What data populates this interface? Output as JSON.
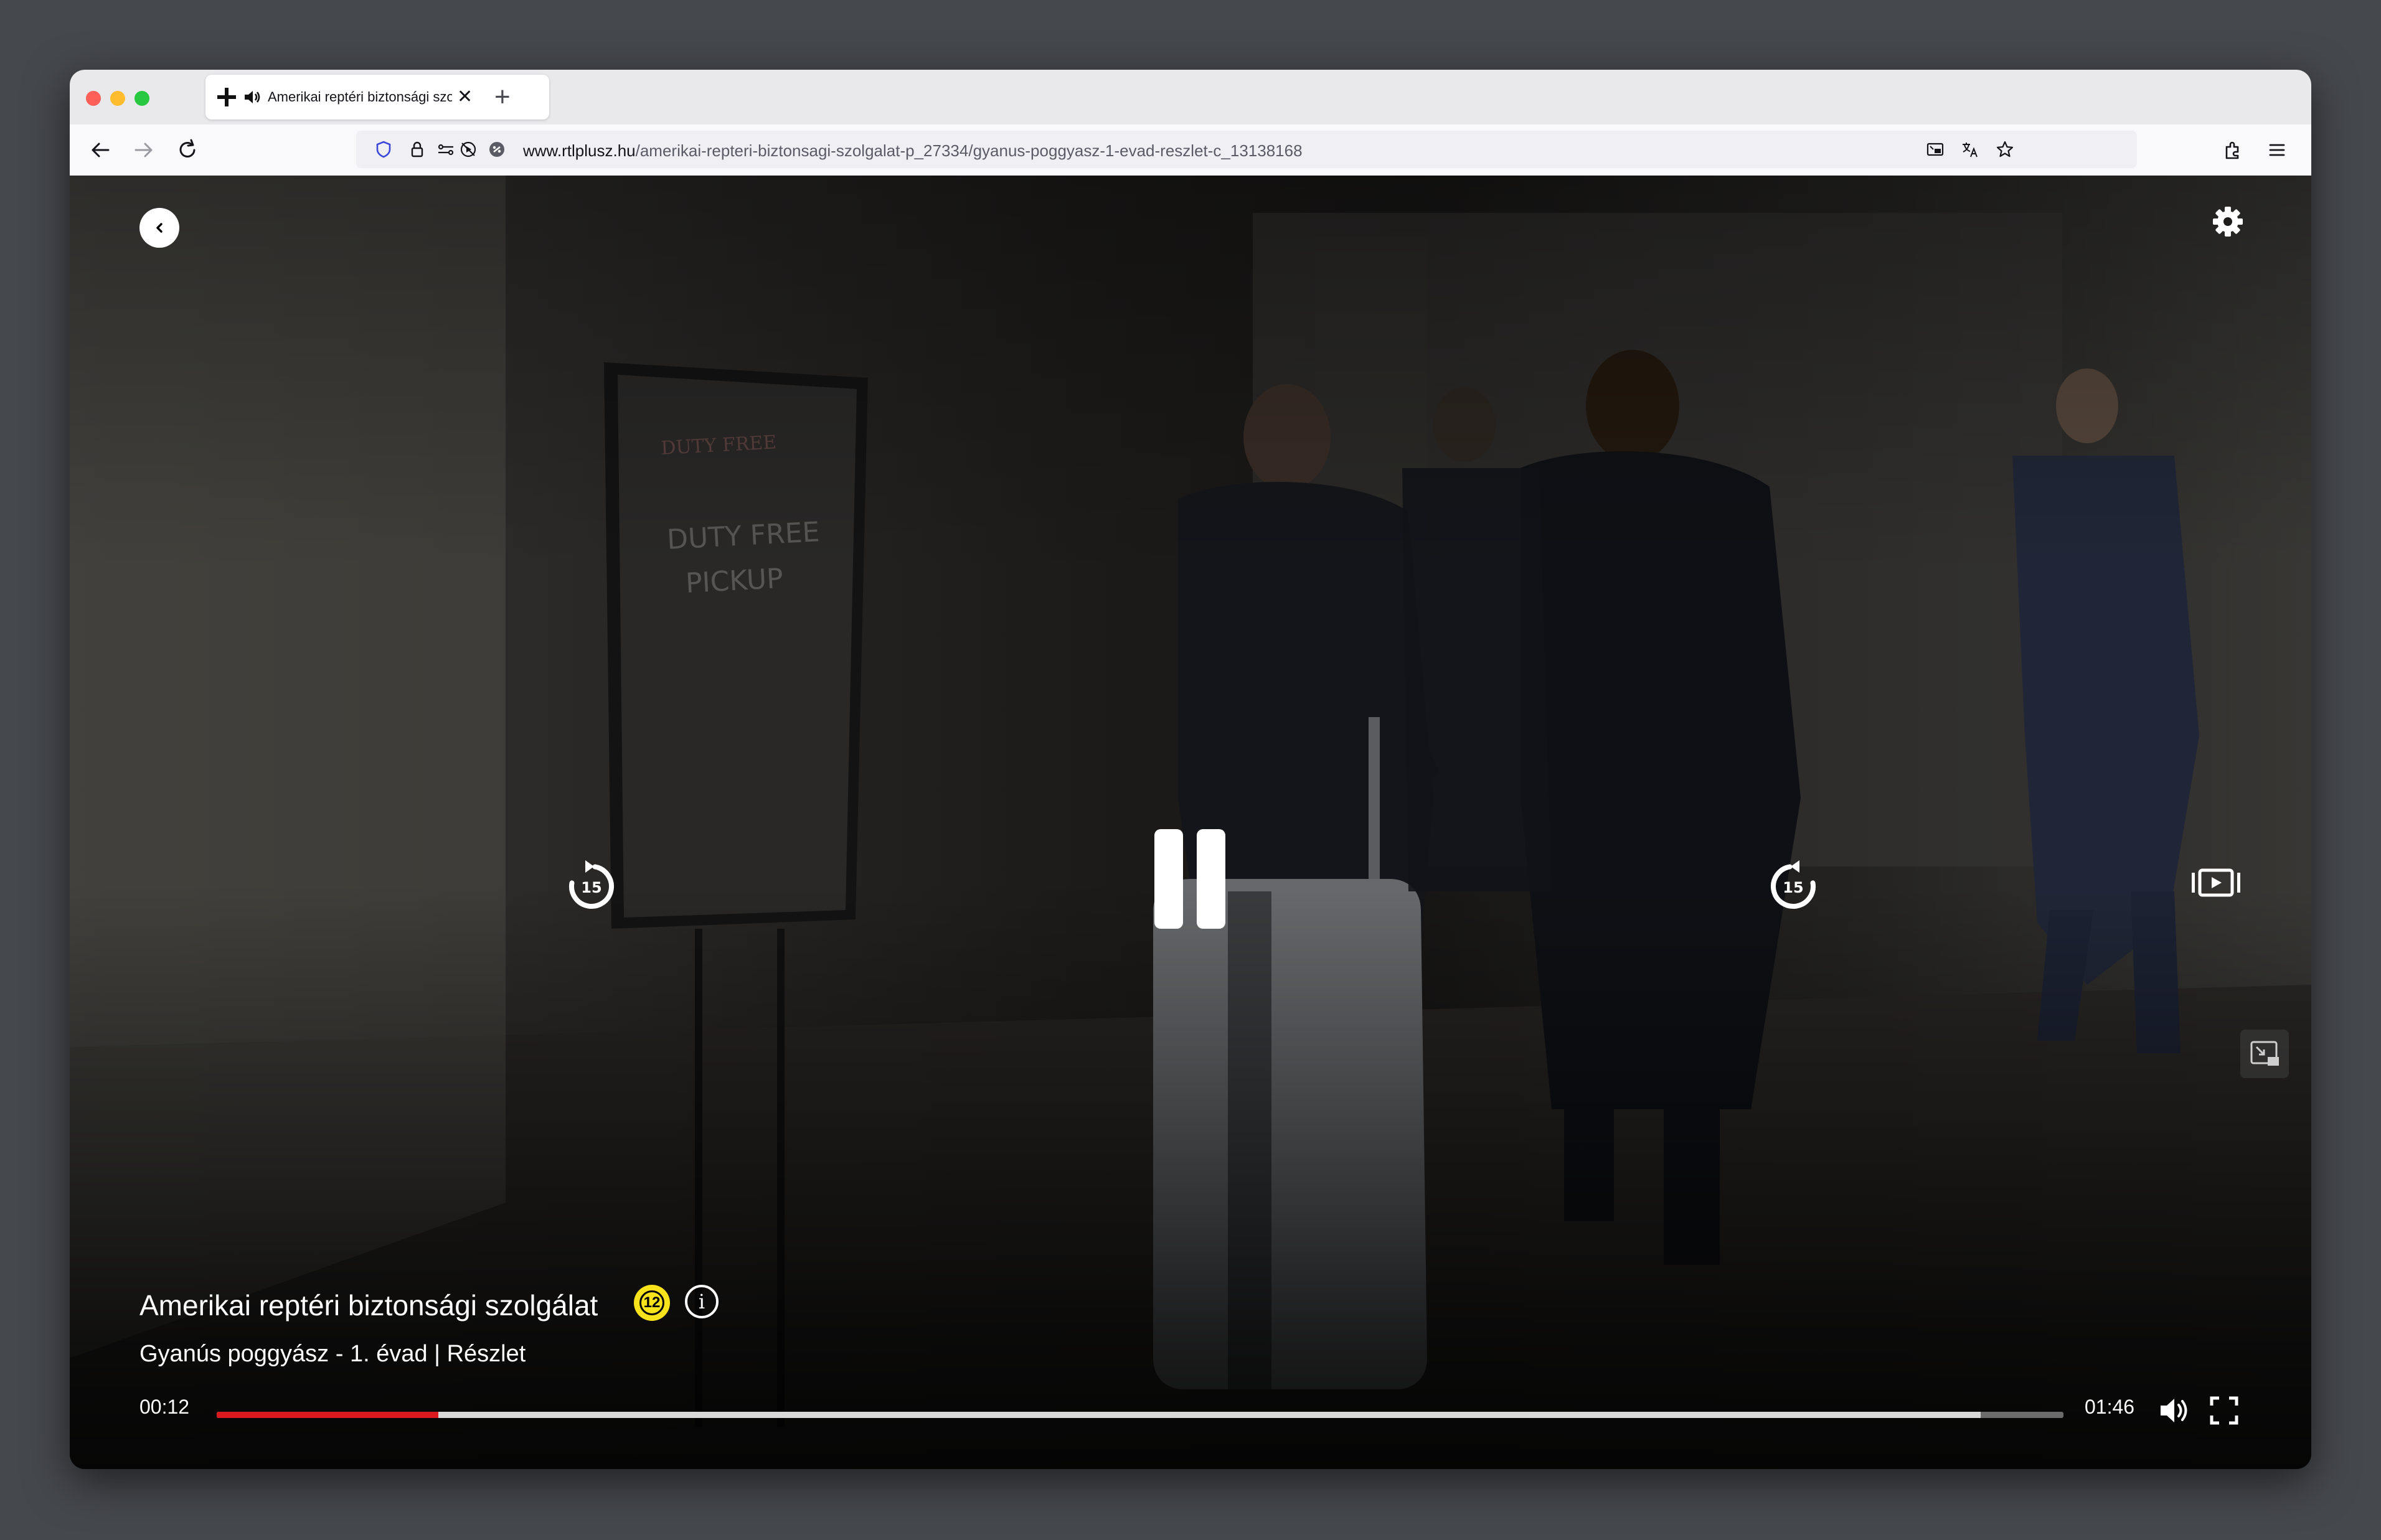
{
  "browser": {
    "tab": {
      "title": "Amerikai reptéri biztonsági szolgálat",
      "close_glyph": "✕"
    },
    "new_tab_glyph": "+",
    "url": {
      "domain": "www.rtlplusz.hu",
      "path": "/amerikai-repteri-biztonsagi-szolgalat-p_27334/gyanus-poggyasz-1-evad-reszlet-c_13138168"
    }
  },
  "player": {
    "show_title": "Amerikai reptéri biztonsági szolgálat",
    "age_rating": "12",
    "info_glyph": "i",
    "episode_title": "Gyanús poggyász - 1. évad | Részlet",
    "current_time": "00:12",
    "duration": "01:46",
    "played_fraction": 0.12,
    "buffered_fraction": 0.955,
    "skip_back_label": "15",
    "skip_forward_label": "15",
    "accent_color": "#d8191e",
    "icons": [
      "back-icon",
      "settings-gear-icon",
      "skip-back-15-icon",
      "pause-icon",
      "skip-forward-15-icon",
      "next-episode-icon",
      "picture-in-picture-icon",
      "volume-icon",
      "fullscreen-icon"
    ]
  }
}
